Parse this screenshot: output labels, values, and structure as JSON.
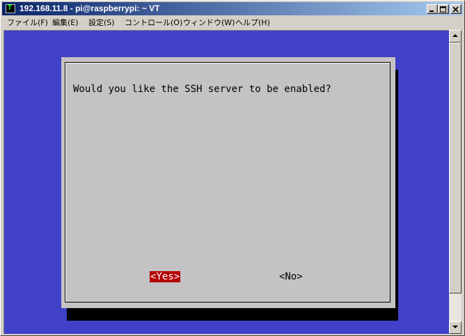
{
  "window": {
    "title": "192.168.11.8 - pi@raspberrypi: ~ VT",
    "app_icon_glyph": "T",
    "buttons": {
      "minimize": "minimize-icon",
      "maximize": "maximize-icon",
      "close": "close-icon"
    }
  },
  "menu": {
    "items": [
      {
        "label": "ファイル(F)"
      },
      {
        "label": "編集(E)"
      },
      {
        "label": "設定(S)"
      },
      {
        "label": "コントロール(O)"
      },
      {
        "label": "ウィンドウ(W)"
      },
      {
        "label": "ヘルプ(H)"
      }
    ]
  },
  "dialog": {
    "question": "Would you like the SSH server to be enabled?",
    "yes_label": "<Yes>",
    "no_label": "<No>",
    "selected": "yes"
  },
  "colors": {
    "terminal_background": "#4040c8",
    "dialog_background": "#c4c2c4",
    "selected_button": "#b40000",
    "title_gradient_start": "#0a246a",
    "title_gradient_end": "#a6caf0"
  }
}
